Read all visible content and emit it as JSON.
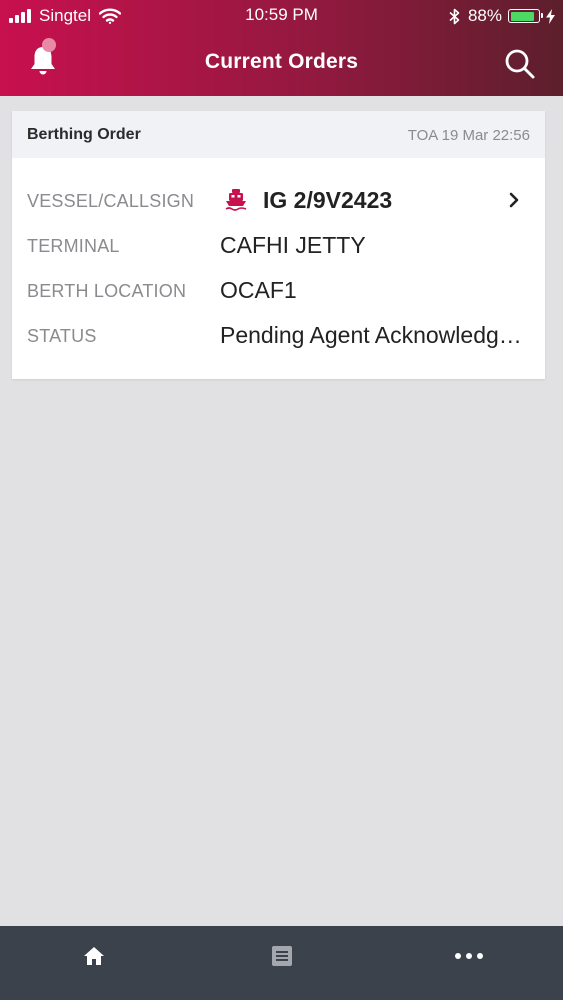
{
  "status_bar": {
    "carrier": "Singtel",
    "time": "10:59 PM",
    "battery_percent": "88%",
    "battery_level": 0.88
  },
  "header": {
    "title": "Current Orders",
    "left_icon": "bell-icon",
    "right_icon": "search-icon"
  },
  "order": {
    "type_label": "Berthing Order",
    "toa": "TOA 19 Mar 22:56",
    "fields": {
      "vessel_label": "VESSEL/CALLSIGN",
      "vessel_value": "IG 2/9V2423",
      "terminal_label": "TERMINAL",
      "terminal_value": "CAFHI JETTY",
      "berth_label": "BERTH LOCATION",
      "berth_value": "OCAF1",
      "status_label": "STATUS",
      "status_value": "Pending Agent Acknowledgement"
    }
  },
  "tabbar": {
    "items": [
      "home-icon",
      "list-icon",
      "more-icon"
    ]
  },
  "colors": {
    "header_start": "#c8104f",
    "header_end": "#5c1f2c",
    "accent": "#c8104f",
    "background": "#e1e1e4",
    "tabbar": "#3c424b"
  }
}
